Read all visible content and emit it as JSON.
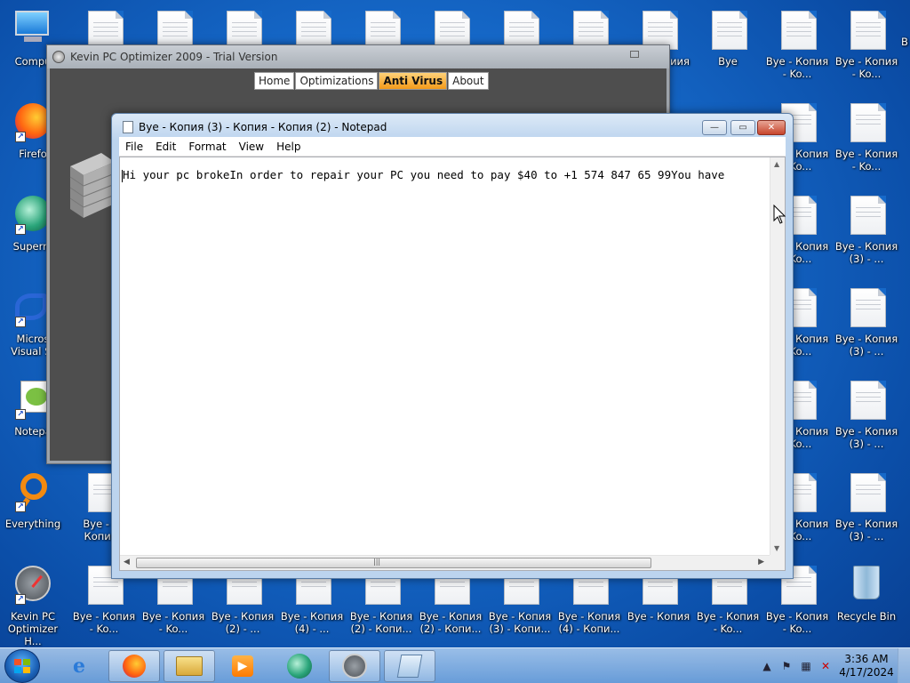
{
  "desktop": {
    "icons": {
      "computer": "Compu",
      "firefox": "Firefo",
      "supermium": "Superm",
      "visual_studio_1": "Micros",
      "visual_studio_2": "Visual St",
      "notepad": "Notepa",
      "everything": "Everything",
      "kevin_optimizer": "Kevin PC Optimizer H...",
      "recycle_bin": "Recycle Bin",
      "bye": "Bye",
      "bye_kopiya": "Bye - Копия",
      "bye_kopiya_ko": "Bye - Копия - Ko...",
      "bye_kopiya3_ko": "Bye - Копия (3) - ...",
      "bye_kopiya_right": "Bye - Копия - Ko...",
      "bye_kopiya2": "Bye - Копия (2) - ...",
      "bye_kopiya4": "Bye - Копия (4) - ...",
      "bye_2_kopi": "Bye - Копия (2) - Копи...",
      "bye_3_kopi": "Bye - Копия (3) - Копи...",
      "bye_4_kopi": "Bye - Копия (4) - Копи...",
      "bye_partial_bottom": "Bye - Ko Копия -",
      "edge_ko": "Копия - Ko...",
      "edge_ia": "иия",
      "edge_b": "B",
      "edge_k": "K"
    }
  },
  "optimizer": {
    "title": "Kevin PC Optimizer 2009 - Trial Version",
    "tabs": [
      "Home",
      "Optimizations",
      "Anti Virus",
      "About"
    ],
    "active_tab": "Anti Virus"
  },
  "notepad": {
    "title": "Bye - Копия (3) - Копия - Копия (2) - Notepad",
    "menu": [
      "File",
      "Edit",
      "Format",
      "View",
      "Help"
    ],
    "content": "Hi your pc brokeIn order to repair your PC you need to pay $40 to +1 574 847 65 99You have"
  },
  "taskbar": {
    "time": "3:36 AM",
    "date": "4/17/2024"
  }
}
